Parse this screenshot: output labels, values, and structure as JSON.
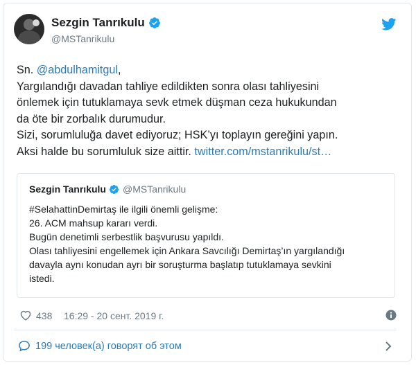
{
  "author": {
    "display_name": "Sezgin Tanrıkulu",
    "handle": "@MSTanrikulu",
    "avatar_icon": "avatar-photo",
    "verified_icon": "verified-badge-icon"
  },
  "tweet": {
    "lines": [
      {
        "prefix": "Sn. ",
        "mention": "@abdulhamitgul",
        "suffix": ","
      },
      {
        "text": "Yargılandığı davadan tahliye edildikten sonra olası tahliyesini"
      },
      {
        "text": "önlemek için tutuklamaya sevk etmek düşman ceza hukukundan"
      },
      {
        "text": "da öte bir zorbalık durumudur."
      },
      {
        "text": "Sizi, sorumluluğa davet ediyoruz; HSK’yı toplayın gereğini yapın."
      },
      {
        "text": "Aksi halde bu sorumluluk size aittir. ",
        "link": "twitter.com/mstanrikulu/st…"
      }
    ]
  },
  "quoted": {
    "display_name": "Sezgin Tanrıkulu",
    "handle": "@MSTanrikulu",
    "lines": [
      "#SelahattinDemirtaş ile ilgili önemli gelişme:",
      "26. ACM mahsup kararı verdi.",
      "Bugün denetimli serbestlik başvurusu yapıldı.",
      "Olası tahliyesini engellemek için Ankara Savcılığı Demirtaş’ın yargılandığı",
      "davayla aynı konudan ayrı bir soruşturma başlatıp tutuklamaya sevkini",
      "istedi."
    ]
  },
  "meta": {
    "like_count": "438",
    "timestamp": "16:29 - 20 сент. 2019 г.",
    "heart_icon": "heart-icon",
    "info_icon": "info-icon"
  },
  "footer": {
    "conversation_label": "199 человек(а) говорят об этом",
    "bubble_icon": "speech-bubble-icon",
    "chevron_icon": "chevron-right-icon"
  },
  "colors": {
    "link": "#2b7bb9",
    "secondary_text": "#697882",
    "border": "#e1e8ed",
    "twitter_blue": "#1da1f2"
  }
}
